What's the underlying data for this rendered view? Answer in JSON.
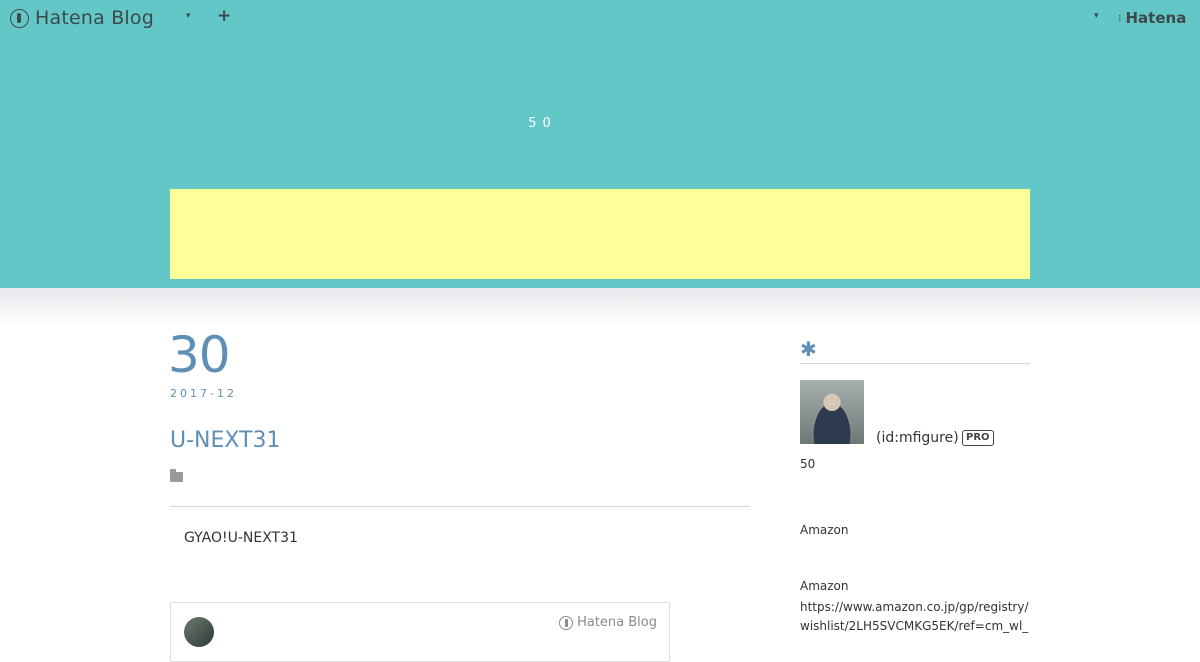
{
  "topbar": {
    "brand_text": "Hatena Blog",
    "menu_caret": "▾",
    "plus_label": "+",
    "right_caret": "▾",
    "hatena_dots": "⁝",
    "hatena_text": "Hatena"
  },
  "header": {
    "blog_title": "50",
    "background_color": "#63c7c8",
    "ad_color": "#ffff99"
  },
  "entry": {
    "date_day": "30",
    "date_year_month": "2017-12",
    "title": "U-NEXT31",
    "body": "GYAO!U-NEXT31",
    "accent_color": "#5f8fb4"
  },
  "embed": {
    "logo_text": "Hatena Blog"
  },
  "sidebar": {
    "heading_icon": "✱",
    "profile_id": "(id:mfigure)",
    "pro_badge": "PRO",
    "profile_desc": "50",
    "amazon_1": "Amazon",
    "amazon_2": "Amazon",
    "amazon_link": "https://www.amazon.co.jp/gp/registry/wishlist/2LH5SVCMKG5EK/ref=cm_wl_"
  }
}
